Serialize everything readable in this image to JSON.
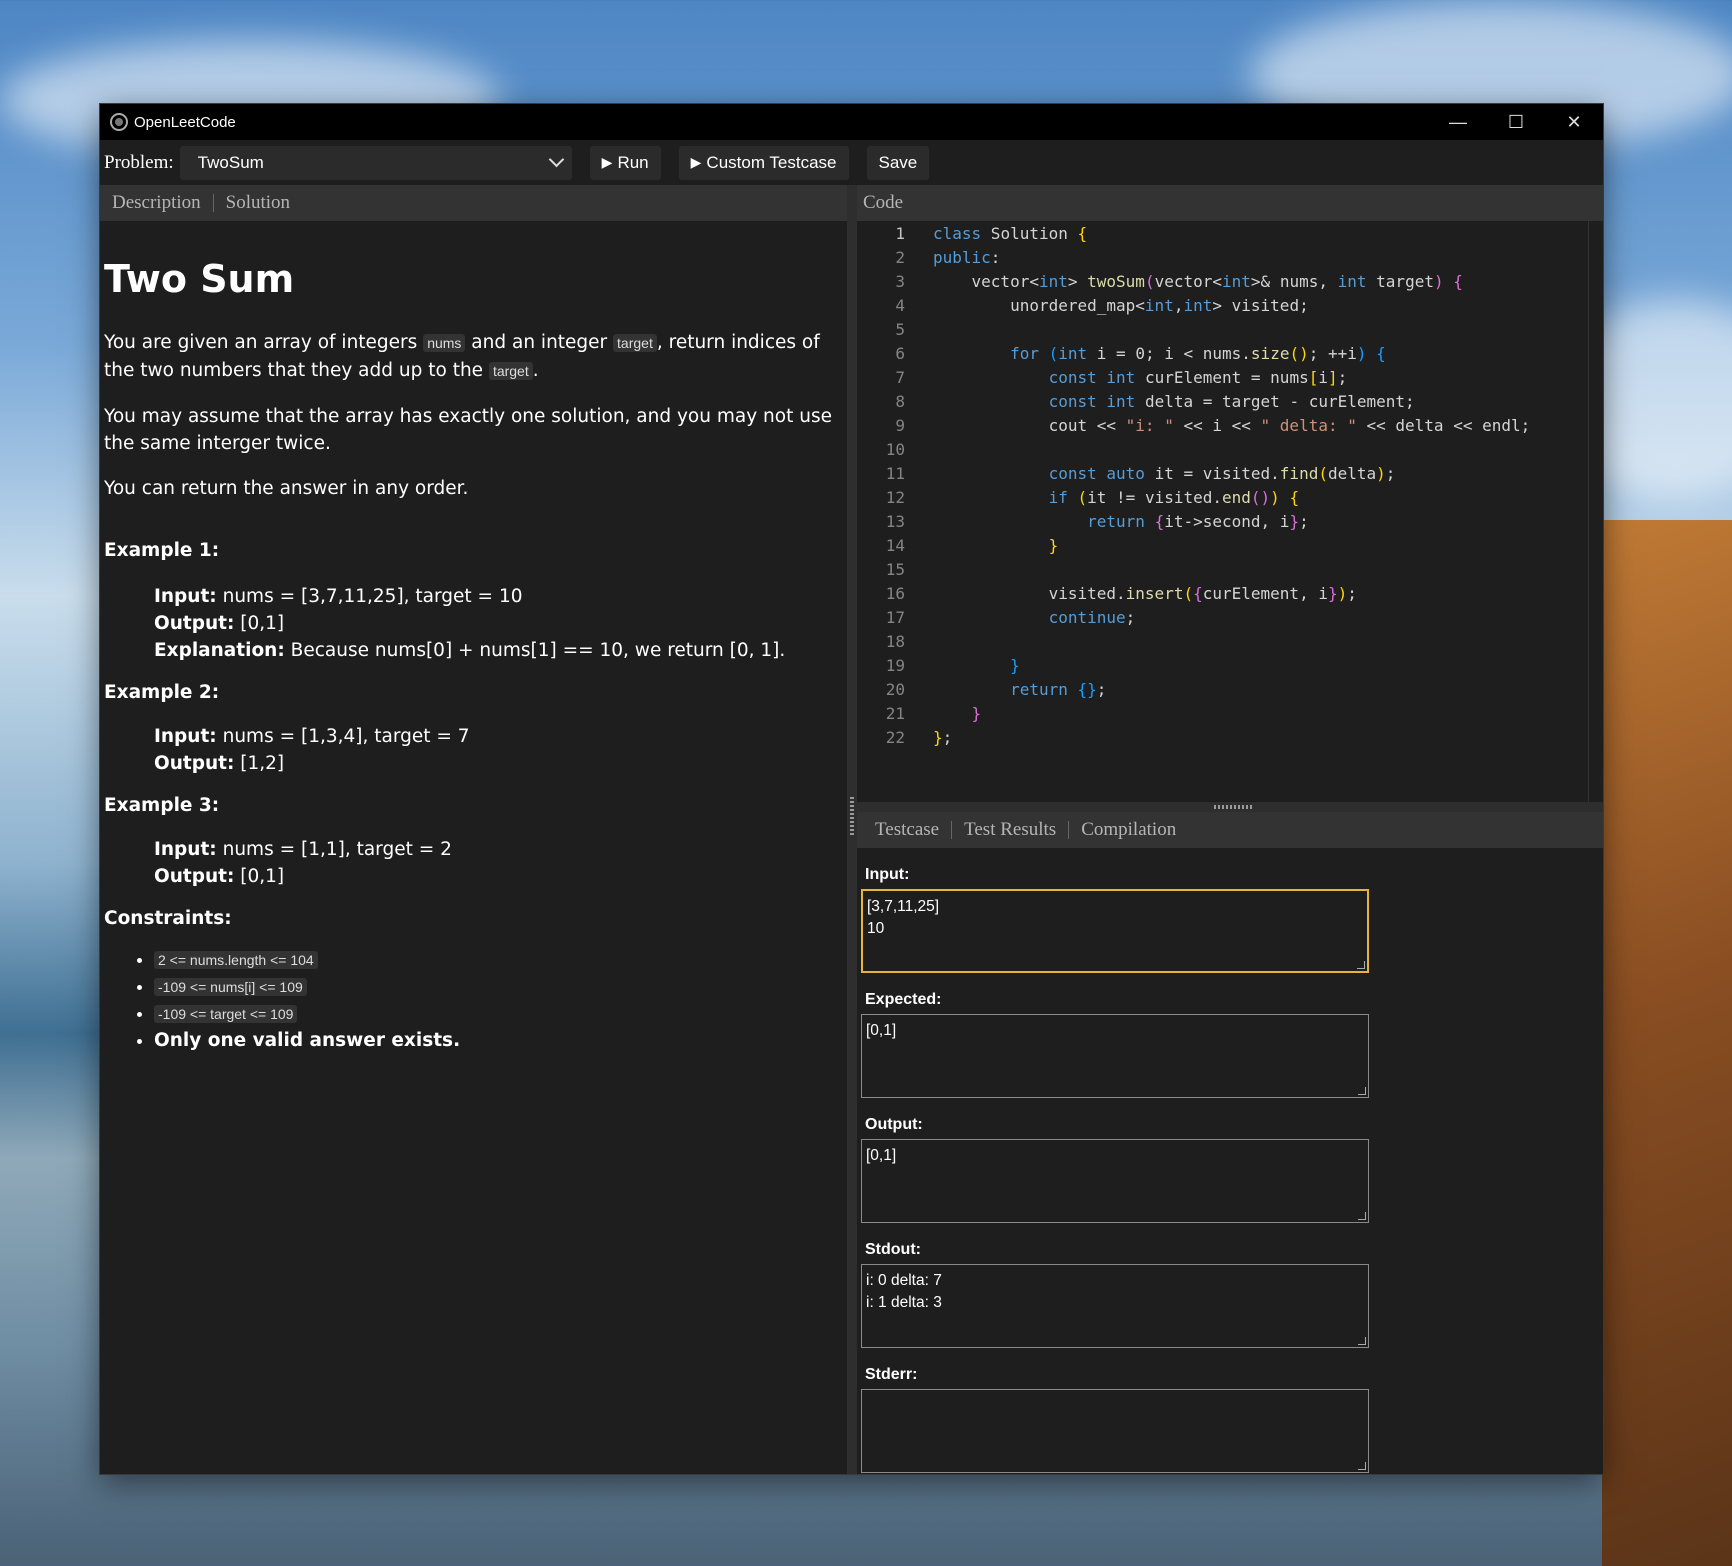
{
  "window": {
    "title": "OpenLeetCode"
  },
  "toolbar": {
    "problem_label": "Problem:",
    "problem_value": "TwoSum",
    "run_label": "Run",
    "custom_label": "Custom Testcase",
    "save_label": "Save"
  },
  "left_tabs": [
    "Description",
    "Solution"
  ],
  "description": {
    "title": "Two Sum",
    "p1": {
      "a": "You are given an array of integers ",
      "code1": "nums",
      "b": " and an integer ",
      "code2": "target",
      "c": ", return indices of the two numbers that they add up to the ",
      "code3": "target",
      "d": "."
    },
    "p2": "You may assume that the array has exactly one solution, and you may not use the same interger twice.",
    "p3": "You can return the answer in any order.",
    "examples": [
      {
        "heading": "Example 1:",
        "input_label": "Input:",
        "input": " nums = [3,7,11,25], target = 10",
        "output_label": "Output:",
        "output": " [0,1]",
        "explanation_label": "Explanation:",
        "explanation": " Because nums[0] + nums[1] == 10, we return [0, 1]."
      },
      {
        "heading": "Example 2:",
        "input_label": "Input:",
        "input": " nums = [1,3,4], target = 7",
        "output_label": "Output:",
        "output": " [1,2]"
      },
      {
        "heading": "Example 3:",
        "input_label": "Input:",
        "input": " nums = [1,1], target = 2",
        "output_label": "Output:",
        "output": " [0,1]"
      }
    ],
    "constraints_heading": "Constraints:",
    "constraints": [
      "2 <= nums.length <= 104",
      "-109 <= nums[i] <= 109",
      "-109 <= target <= 109"
    ],
    "constraint_strong": "Only one valid answer exists."
  },
  "code_tab": "Code",
  "code_lines": [
    "1",
    "2",
    "3",
    "4",
    "5",
    "6",
    "7",
    "8",
    "9",
    "10",
    "11",
    "12",
    "13",
    "14",
    "15",
    "16",
    "17",
    "18",
    "19",
    "20",
    "21",
    "22"
  ],
  "bottom_tabs": [
    "Testcase",
    "Test Results",
    "Compilation"
  ],
  "fields": {
    "input_label": "Input:",
    "input_value": "[3,7,11,25]\n10",
    "expected_label": "Expected:",
    "expected_value": "[0,1]",
    "output_label": "Output:",
    "output_value": "[0,1]",
    "stdout_label": "Stdout:",
    "stdout_value": "i: 0 delta: 7\ni: 1 delta: 3",
    "stderr_label": "Stderr:",
    "stderr_value": ""
  },
  "colors": {
    "accent_focus": "#e8b33b",
    "keyword": "#569cd6",
    "string": "#ce9178"
  }
}
